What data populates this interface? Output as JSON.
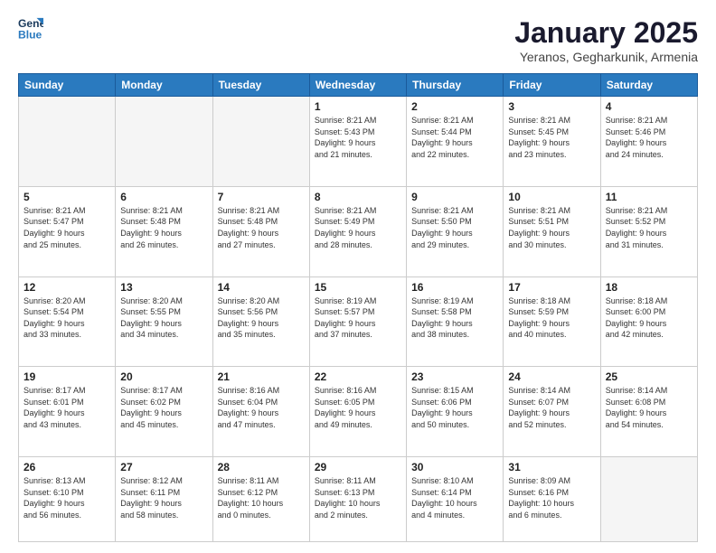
{
  "logo": {
    "line1": "General",
    "line2": "Blue"
  },
  "title": "January 2025",
  "location": "Yeranos, Gegharkunik, Armenia",
  "days_header": [
    "Sunday",
    "Monday",
    "Tuesday",
    "Wednesday",
    "Thursday",
    "Friday",
    "Saturday"
  ],
  "weeks": [
    [
      {
        "day": "",
        "content": ""
      },
      {
        "day": "",
        "content": ""
      },
      {
        "day": "",
        "content": ""
      },
      {
        "day": "1",
        "content": "Sunrise: 8:21 AM\nSunset: 5:43 PM\nDaylight: 9 hours\nand 21 minutes."
      },
      {
        "day": "2",
        "content": "Sunrise: 8:21 AM\nSunset: 5:44 PM\nDaylight: 9 hours\nand 22 minutes."
      },
      {
        "day": "3",
        "content": "Sunrise: 8:21 AM\nSunset: 5:45 PM\nDaylight: 9 hours\nand 23 minutes."
      },
      {
        "day": "4",
        "content": "Sunrise: 8:21 AM\nSunset: 5:46 PM\nDaylight: 9 hours\nand 24 minutes."
      }
    ],
    [
      {
        "day": "5",
        "content": "Sunrise: 8:21 AM\nSunset: 5:47 PM\nDaylight: 9 hours\nand 25 minutes."
      },
      {
        "day": "6",
        "content": "Sunrise: 8:21 AM\nSunset: 5:48 PM\nDaylight: 9 hours\nand 26 minutes."
      },
      {
        "day": "7",
        "content": "Sunrise: 8:21 AM\nSunset: 5:48 PM\nDaylight: 9 hours\nand 27 minutes."
      },
      {
        "day": "8",
        "content": "Sunrise: 8:21 AM\nSunset: 5:49 PM\nDaylight: 9 hours\nand 28 minutes."
      },
      {
        "day": "9",
        "content": "Sunrise: 8:21 AM\nSunset: 5:50 PM\nDaylight: 9 hours\nand 29 minutes."
      },
      {
        "day": "10",
        "content": "Sunrise: 8:21 AM\nSunset: 5:51 PM\nDaylight: 9 hours\nand 30 minutes."
      },
      {
        "day": "11",
        "content": "Sunrise: 8:21 AM\nSunset: 5:52 PM\nDaylight: 9 hours\nand 31 minutes."
      }
    ],
    [
      {
        "day": "12",
        "content": "Sunrise: 8:20 AM\nSunset: 5:54 PM\nDaylight: 9 hours\nand 33 minutes."
      },
      {
        "day": "13",
        "content": "Sunrise: 8:20 AM\nSunset: 5:55 PM\nDaylight: 9 hours\nand 34 minutes."
      },
      {
        "day": "14",
        "content": "Sunrise: 8:20 AM\nSunset: 5:56 PM\nDaylight: 9 hours\nand 35 minutes."
      },
      {
        "day": "15",
        "content": "Sunrise: 8:19 AM\nSunset: 5:57 PM\nDaylight: 9 hours\nand 37 minutes."
      },
      {
        "day": "16",
        "content": "Sunrise: 8:19 AM\nSunset: 5:58 PM\nDaylight: 9 hours\nand 38 minutes."
      },
      {
        "day": "17",
        "content": "Sunrise: 8:18 AM\nSunset: 5:59 PM\nDaylight: 9 hours\nand 40 minutes."
      },
      {
        "day": "18",
        "content": "Sunrise: 8:18 AM\nSunset: 6:00 PM\nDaylight: 9 hours\nand 42 minutes."
      }
    ],
    [
      {
        "day": "19",
        "content": "Sunrise: 8:17 AM\nSunset: 6:01 PM\nDaylight: 9 hours\nand 43 minutes."
      },
      {
        "day": "20",
        "content": "Sunrise: 8:17 AM\nSunset: 6:02 PM\nDaylight: 9 hours\nand 45 minutes."
      },
      {
        "day": "21",
        "content": "Sunrise: 8:16 AM\nSunset: 6:04 PM\nDaylight: 9 hours\nand 47 minutes."
      },
      {
        "day": "22",
        "content": "Sunrise: 8:16 AM\nSunset: 6:05 PM\nDaylight: 9 hours\nand 49 minutes."
      },
      {
        "day": "23",
        "content": "Sunrise: 8:15 AM\nSunset: 6:06 PM\nDaylight: 9 hours\nand 50 minutes."
      },
      {
        "day": "24",
        "content": "Sunrise: 8:14 AM\nSunset: 6:07 PM\nDaylight: 9 hours\nand 52 minutes."
      },
      {
        "day": "25",
        "content": "Sunrise: 8:14 AM\nSunset: 6:08 PM\nDaylight: 9 hours\nand 54 minutes."
      }
    ],
    [
      {
        "day": "26",
        "content": "Sunrise: 8:13 AM\nSunset: 6:10 PM\nDaylight: 9 hours\nand 56 minutes."
      },
      {
        "day": "27",
        "content": "Sunrise: 8:12 AM\nSunset: 6:11 PM\nDaylight: 9 hours\nand 58 minutes."
      },
      {
        "day": "28",
        "content": "Sunrise: 8:11 AM\nSunset: 6:12 PM\nDaylight: 10 hours\nand 0 minutes."
      },
      {
        "day": "29",
        "content": "Sunrise: 8:11 AM\nSunset: 6:13 PM\nDaylight: 10 hours\nand 2 minutes."
      },
      {
        "day": "30",
        "content": "Sunrise: 8:10 AM\nSunset: 6:14 PM\nDaylight: 10 hours\nand 4 minutes."
      },
      {
        "day": "31",
        "content": "Sunrise: 8:09 AM\nSunset: 6:16 PM\nDaylight: 10 hours\nand 6 minutes."
      },
      {
        "day": "",
        "content": ""
      }
    ]
  ]
}
